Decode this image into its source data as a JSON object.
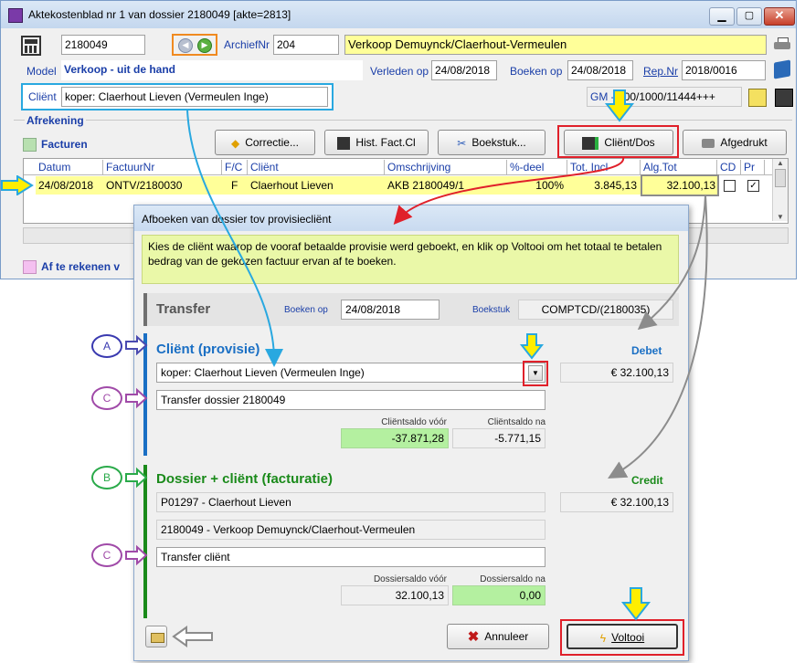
{
  "main_window": {
    "title": "Aktekostenblad nr 1 van dossier 2180049 [akte=2813]",
    "dossier_nr": "2180049",
    "archief_label": "ArchiefNr",
    "archief_value": "204",
    "description": "Verkoop Demuynck/Claerhout-Vermeulen",
    "model_label": "Model",
    "model_value": "Verkoop - uit de hand",
    "verleden_label": "Verleden op",
    "verleden_value": "24/08/2018",
    "boeken_label": "Boeken op",
    "boeken_value": "24/08/2018",
    "rep_label": "Rep.Nr",
    "rep_value": "2018/0016",
    "client_label": "Cliënt",
    "client_value": "koper: Claerhout Lieven (Vermeulen Inge)",
    "gm_label": "GM -",
    "gm_value": "000/1000/11444+++",
    "afrekening_label": "Afrekening",
    "facturen_label": "Facturen",
    "buttons": {
      "correctie": "Correctie...",
      "hist": "Hist. Fact.Cl",
      "boekstuk": "Boekstuk...",
      "client_dos": "Cliënt/Dos",
      "afgedrukt": "Afgedrukt"
    },
    "table": {
      "headers": [
        "Datum",
        "FactuurNr",
        "F/C",
        "Cliënt",
        "Omschrijving",
        "%-deel",
        "Tot. Incl",
        "Alg.Tot",
        "CD",
        "Pr"
      ],
      "row": [
        "24/08/2018",
        "ONTV/2180030",
        "F",
        "Claerhout Lieven",
        "AKB 2180049/1",
        "100%",
        "3.845,13",
        "32.100,13"
      ]
    },
    "af_te_rekenen": "Af te rekenen v"
  },
  "dialog": {
    "title": "Afboeken van dossier tov provisiecliënt",
    "instructions": "Kies de cliënt waarop de vooraf betaalde provisie werd geboekt, en klik op Voltooi om het totaal te betalen bedrag van de gekozen factuur ervan af te boeken.",
    "transfer_label": "Transfer",
    "boeken_label": "Boeken op",
    "boeken_value": "24/08/2018",
    "boekstuk_label": "Boekstuk",
    "boekstuk_value": "COMPTCD/(2180035)",
    "client_section": {
      "heading": "Cliënt (provisie)",
      "debet_label": "Debet",
      "client_select": "koper: Claerhout Lieven (Vermeulen Inge)",
      "amount": "€ 32.100,13",
      "memo": "Transfer dossier 2180049",
      "saldo_voor_label": "Cliëntsaldo vóór",
      "saldo_na_label": "Cliëntsaldo na",
      "saldo_voor": "-37.871,28",
      "saldo_na": "-5.771,15"
    },
    "dossier_section": {
      "heading": "Dossier + cliënt (facturatie)",
      "credit_label": "Credit",
      "client_line": "P01297 - Claerhout Lieven",
      "amount": "€ 32.100,13",
      "dossier_line": "2180049 - Verkoop Demuynck/Claerhout-Vermeulen",
      "memo": "Transfer cliënt",
      "saldo_voor_label": "Dossiersaldo vóór",
      "saldo_na_label": "Dossiersaldo na",
      "saldo_voor": "32.100,13",
      "saldo_na": "0,00"
    },
    "annuleer": "Annuleer",
    "voltooi": "Voltooi"
  },
  "annotations": {
    "a": "A",
    "b": "B",
    "c1": "C",
    "c2": "C",
    "c3": "C"
  },
  "colors": {
    "client_blue": "#1a6fc4",
    "dossier_green": "#1a8a1a",
    "highlight_yellow": "#ffff99",
    "callout_red": "#e0202a",
    "arrow_blue": "#29a8e0",
    "arrow_gray": "#8c8c8c",
    "arrow_yellow": "#ffee00",
    "saldo_green": "#b4f0a0",
    "note_bg": "#eaf8a8"
  }
}
